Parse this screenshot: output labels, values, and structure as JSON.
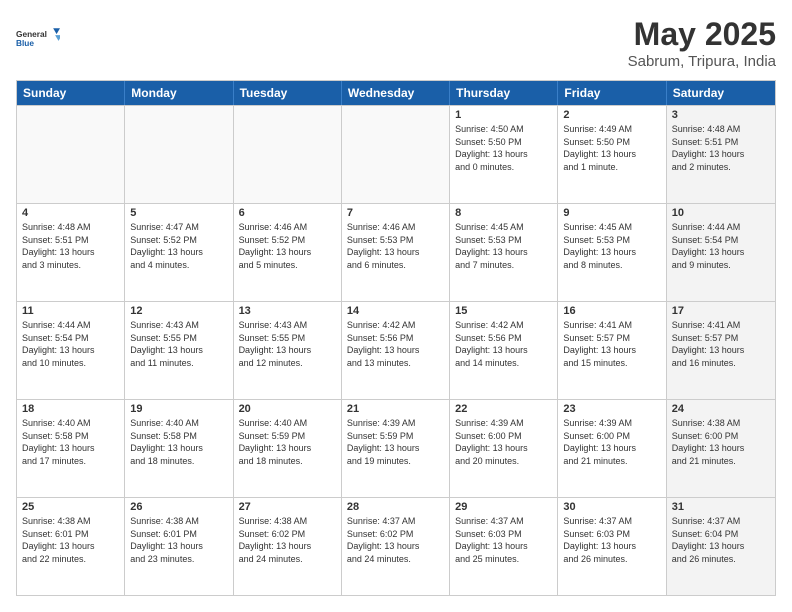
{
  "logo": {
    "general": "General",
    "blue": "Blue"
  },
  "title": "May 2025",
  "location": "Sabrum, Tripura, India",
  "weekdays": [
    "Sunday",
    "Monday",
    "Tuesday",
    "Wednesday",
    "Thursday",
    "Friday",
    "Saturday"
  ],
  "rows": [
    [
      {
        "day": "",
        "empty": true
      },
      {
        "day": "",
        "empty": true
      },
      {
        "day": "",
        "empty": true
      },
      {
        "day": "",
        "empty": true
      },
      {
        "day": "1",
        "line1": "Sunrise: 4:50 AM",
        "line2": "Sunset: 5:50 PM",
        "line3": "Daylight: 13 hours",
        "line4": "and 0 minutes."
      },
      {
        "day": "2",
        "line1": "Sunrise: 4:49 AM",
        "line2": "Sunset: 5:50 PM",
        "line3": "Daylight: 13 hours",
        "line4": "and 1 minute."
      },
      {
        "day": "3",
        "line1": "Sunrise: 4:48 AM",
        "line2": "Sunset: 5:51 PM",
        "line3": "Daylight: 13 hours",
        "line4": "and 2 minutes.",
        "alt": true
      }
    ],
    [
      {
        "day": "4",
        "line1": "Sunrise: 4:48 AM",
        "line2": "Sunset: 5:51 PM",
        "line3": "Daylight: 13 hours",
        "line4": "and 3 minutes."
      },
      {
        "day": "5",
        "line1": "Sunrise: 4:47 AM",
        "line2": "Sunset: 5:52 PM",
        "line3": "Daylight: 13 hours",
        "line4": "and 4 minutes."
      },
      {
        "day": "6",
        "line1": "Sunrise: 4:46 AM",
        "line2": "Sunset: 5:52 PM",
        "line3": "Daylight: 13 hours",
        "line4": "and 5 minutes."
      },
      {
        "day": "7",
        "line1": "Sunrise: 4:46 AM",
        "line2": "Sunset: 5:53 PM",
        "line3": "Daylight: 13 hours",
        "line4": "and 6 minutes."
      },
      {
        "day": "8",
        "line1": "Sunrise: 4:45 AM",
        "line2": "Sunset: 5:53 PM",
        "line3": "Daylight: 13 hours",
        "line4": "and 7 minutes."
      },
      {
        "day": "9",
        "line1": "Sunrise: 4:45 AM",
        "line2": "Sunset: 5:53 PM",
        "line3": "Daylight: 13 hours",
        "line4": "and 8 minutes."
      },
      {
        "day": "10",
        "line1": "Sunrise: 4:44 AM",
        "line2": "Sunset: 5:54 PM",
        "line3": "Daylight: 13 hours",
        "line4": "and 9 minutes.",
        "alt": true
      }
    ],
    [
      {
        "day": "11",
        "line1": "Sunrise: 4:44 AM",
        "line2": "Sunset: 5:54 PM",
        "line3": "Daylight: 13 hours",
        "line4": "and 10 minutes."
      },
      {
        "day": "12",
        "line1": "Sunrise: 4:43 AM",
        "line2": "Sunset: 5:55 PM",
        "line3": "Daylight: 13 hours",
        "line4": "and 11 minutes."
      },
      {
        "day": "13",
        "line1": "Sunrise: 4:43 AM",
        "line2": "Sunset: 5:55 PM",
        "line3": "Daylight: 13 hours",
        "line4": "and 12 minutes."
      },
      {
        "day": "14",
        "line1": "Sunrise: 4:42 AM",
        "line2": "Sunset: 5:56 PM",
        "line3": "Daylight: 13 hours",
        "line4": "and 13 minutes."
      },
      {
        "day": "15",
        "line1": "Sunrise: 4:42 AM",
        "line2": "Sunset: 5:56 PM",
        "line3": "Daylight: 13 hours",
        "line4": "and 14 minutes."
      },
      {
        "day": "16",
        "line1": "Sunrise: 4:41 AM",
        "line2": "Sunset: 5:57 PM",
        "line3": "Daylight: 13 hours",
        "line4": "and 15 minutes."
      },
      {
        "day": "17",
        "line1": "Sunrise: 4:41 AM",
        "line2": "Sunset: 5:57 PM",
        "line3": "Daylight: 13 hours",
        "line4": "and 16 minutes.",
        "alt": true
      }
    ],
    [
      {
        "day": "18",
        "line1": "Sunrise: 4:40 AM",
        "line2": "Sunset: 5:58 PM",
        "line3": "Daylight: 13 hours",
        "line4": "and 17 minutes."
      },
      {
        "day": "19",
        "line1": "Sunrise: 4:40 AM",
        "line2": "Sunset: 5:58 PM",
        "line3": "Daylight: 13 hours",
        "line4": "and 18 minutes."
      },
      {
        "day": "20",
        "line1": "Sunrise: 4:40 AM",
        "line2": "Sunset: 5:59 PM",
        "line3": "Daylight: 13 hours",
        "line4": "and 18 minutes."
      },
      {
        "day": "21",
        "line1": "Sunrise: 4:39 AM",
        "line2": "Sunset: 5:59 PM",
        "line3": "Daylight: 13 hours",
        "line4": "and 19 minutes."
      },
      {
        "day": "22",
        "line1": "Sunrise: 4:39 AM",
        "line2": "Sunset: 6:00 PM",
        "line3": "Daylight: 13 hours",
        "line4": "and 20 minutes."
      },
      {
        "day": "23",
        "line1": "Sunrise: 4:39 AM",
        "line2": "Sunset: 6:00 PM",
        "line3": "Daylight: 13 hours",
        "line4": "and 21 minutes."
      },
      {
        "day": "24",
        "line1": "Sunrise: 4:38 AM",
        "line2": "Sunset: 6:00 PM",
        "line3": "Daylight: 13 hours",
        "line4": "and 21 minutes.",
        "alt": true
      }
    ],
    [
      {
        "day": "25",
        "line1": "Sunrise: 4:38 AM",
        "line2": "Sunset: 6:01 PM",
        "line3": "Daylight: 13 hours",
        "line4": "and 22 minutes."
      },
      {
        "day": "26",
        "line1": "Sunrise: 4:38 AM",
        "line2": "Sunset: 6:01 PM",
        "line3": "Daylight: 13 hours",
        "line4": "and 23 minutes."
      },
      {
        "day": "27",
        "line1": "Sunrise: 4:38 AM",
        "line2": "Sunset: 6:02 PM",
        "line3": "Daylight: 13 hours",
        "line4": "and 24 minutes."
      },
      {
        "day": "28",
        "line1": "Sunrise: 4:37 AM",
        "line2": "Sunset: 6:02 PM",
        "line3": "Daylight: 13 hours",
        "line4": "and 24 minutes."
      },
      {
        "day": "29",
        "line1": "Sunrise: 4:37 AM",
        "line2": "Sunset: 6:03 PM",
        "line3": "Daylight: 13 hours",
        "line4": "and 25 minutes."
      },
      {
        "day": "30",
        "line1": "Sunrise: 4:37 AM",
        "line2": "Sunset: 6:03 PM",
        "line3": "Daylight: 13 hours",
        "line4": "and 26 minutes."
      },
      {
        "day": "31",
        "line1": "Sunrise: 4:37 AM",
        "line2": "Sunset: 6:04 PM",
        "line3": "Daylight: 13 hours",
        "line4": "and 26 minutes.",
        "alt": true
      }
    ]
  ]
}
